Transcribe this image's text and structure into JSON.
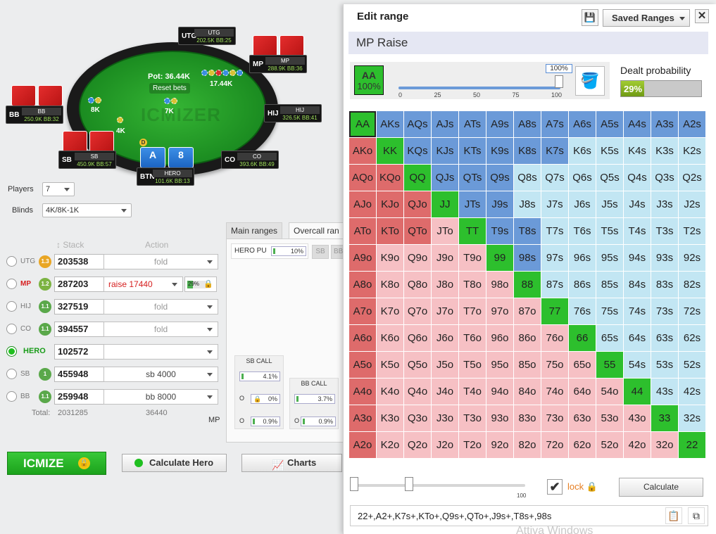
{
  "table": {
    "pot": "Pot: 36.44K",
    "reset": "Reset bets",
    "watermark": "ICMIZER",
    "bets": {
      "bb": "8K",
      "sb": "4K",
      "hero": "7K",
      "mp": "17.44K"
    },
    "dealer": "D",
    "hero_cards": [
      "A",
      "8"
    ],
    "seats": {
      "utg": {
        "pos": "UTG",
        "name": "UTG",
        "stack": "202.5K",
        "bb": "BB:25"
      },
      "mp": {
        "pos": "MP",
        "name": "MP",
        "stack": "288.9K",
        "bb": "BB:36"
      },
      "hij": {
        "pos": "HIJ",
        "name": "HIJ",
        "stack": "326.5K",
        "bb": "BB:41"
      },
      "co": {
        "pos": "CO",
        "name": "CO",
        "stack": "393.6K",
        "bb": "BB:49"
      },
      "btn": {
        "pos": "BTN",
        "name": "HERO",
        "stack": "101.6K",
        "bb": "BB:13"
      },
      "sb": {
        "pos": "SB",
        "name": "SB",
        "stack": "450.9K",
        "bb": "BB:57"
      },
      "bb": {
        "pos": "BB",
        "name": "BB",
        "stack": "250.9K",
        "bb": "BB:32"
      }
    }
  },
  "controls": {
    "players_label": "Players",
    "players_value": "7",
    "blinds_label": "Blinds",
    "blinds_value": "4K/8K-1K",
    "stack_header": "Stack",
    "action_header": "Action",
    "rows": [
      {
        "name": "UTG",
        "badge": "1.3",
        "stack": "203538",
        "action": "fold"
      },
      {
        "name": "MP",
        "badge": "1.2",
        "stack": "287203",
        "action": "raise 17440",
        "pct": "29%"
      },
      {
        "name": "HIJ",
        "badge": "1.1",
        "stack": "327519",
        "action": "fold"
      },
      {
        "name": "CO",
        "badge": "1.1",
        "stack": "394557",
        "action": "fold"
      },
      {
        "name": "HERO",
        "badge": "",
        "stack": "102572",
        "action": ""
      },
      {
        "name": "SB",
        "badge": "1",
        "stack": "455948",
        "action": "sb 4000"
      },
      {
        "name": "BB",
        "badge": "1.1",
        "stack": "259948",
        "action": "bb 8000"
      }
    ],
    "total_label": "Total:",
    "total_stack": "2031285",
    "total_action": "36440",
    "mp_label": "MP"
  },
  "center": {
    "tab_main": "Main ranges",
    "tab_overcall": "Overcall ran",
    "hero_pu": "HERO PU",
    "hero_pu_pct": "10%",
    "sb_tab": "SB",
    "bb_tab": "BB",
    "sb_call": {
      "title": "SB CALL",
      "v1": "4.1%",
      "v2": "0%",
      "v3": "0.9%",
      "o": "O"
    },
    "bb_call": {
      "title": "BB CALL",
      "v1": "3.7%",
      "v2": "0.9%",
      "o": "O"
    }
  },
  "buttons": {
    "icmize": "ICMIZE",
    "calc_hero": "Calculate Hero",
    "charts": "Charts"
  },
  "edit": {
    "title": "Edit range",
    "saved": "Saved Ranges",
    "range_name": "MP Raise",
    "sel_hand": "AA",
    "sel_pct": "100%",
    "slider_val": "100%",
    "slider_ticks": [
      "0",
      "25",
      "50",
      "75",
      "100"
    ],
    "dealt_label": "Dealt probability",
    "dealt_val": "29%",
    "dealt_frac": 0.29,
    "bottom_min": "100",
    "lock": "lock",
    "calculate": "Calculate",
    "range_text": "22+,A2+,K7s+,KTo+,Q9s+,QTo+,J9s+,T8s+,98s",
    "os_watermark": "Attiva Windows"
  },
  "colors": {
    "pair": "#2dbf2d",
    "suited_in": "#6b9ad8",
    "offsuit_in": "#de6b6b",
    "suited_out": "#c2e6f3",
    "offsuit_out": "#f6c0c4"
  }
}
